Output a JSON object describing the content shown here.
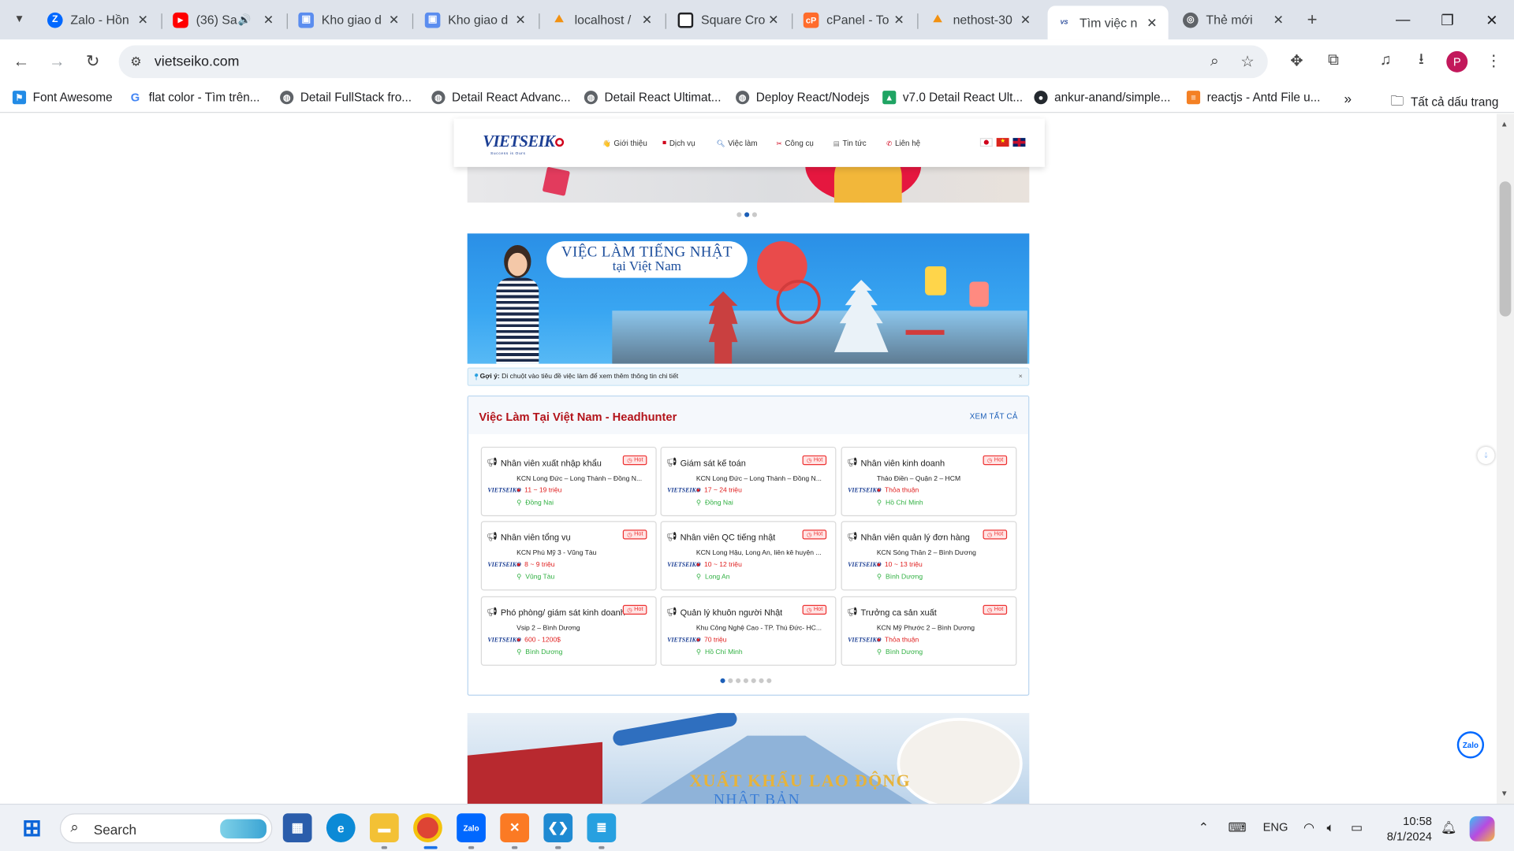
{
  "browser": {
    "tabs": [
      {
        "title": "Zalo - Hồn",
        "icon": "zalo-icon",
        "color": "#0068ff"
      },
      {
        "title": "(36) Sa",
        "icon": "youtube-icon",
        "color": "#ff0000"
      },
      {
        "title": "Kho giao d",
        "icon": "image-icon",
        "color": "#5b8def"
      },
      {
        "title": "Kho giao d",
        "icon": "image-icon",
        "color": "#5b8def"
      },
      {
        "title": "localhost /",
        "icon": "phpmyadmin-icon",
        "color": "#f29111"
      },
      {
        "title": "Square Cro",
        "icon": "square-icon",
        "color": "#202124"
      },
      {
        "title": "cPanel - To",
        "icon": "cpanel-icon",
        "color": "#ff6c2c"
      },
      {
        "title": "nethost-30",
        "icon": "phpmyadmin-icon",
        "color": "#f29111"
      },
      {
        "title": "Tìm việc n",
        "icon": "vietseiko-icon",
        "color": "#1c3f94"
      },
      {
        "title": "Thẻ mới",
        "icon": "chrome-icon",
        "color": "#5f6368"
      }
    ],
    "address": "vietseiko.com",
    "bookmarks": [
      {
        "label": "Font Awesome",
        "icon": "flag-icon",
        "color": "#228be6"
      },
      {
        "label": "flat color - Tìm trên...",
        "icon": "google-icon",
        "color": "#4285f4"
      },
      {
        "label": "Detail FullStack fro...",
        "icon": "globe-icon",
        "color": "#5f6368"
      },
      {
        "label": "Detail React Advanc...",
        "icon": "globe-icon",
        "color": "#5f6368"
      },
      {
        "label": "Detail React Ultimat...",
        "icon": "globe-icon",
        "color": "#5f6368"
      },
      {
        "label": "Deploy React/Nodejs",
        "icon": "globe-icon",
        "color": "#5f6368"
      },
      {
        "label": "v7.0 Detail React Ult...",
        "icon": "drive-icon",
        "color": "#1fa463"
      },
      {
        "label": "ankur-anand/simple...",
        "icon": "github-icon",
        "color": "#24292f"
      },
      {
        "label": "reactjs - Antd File u...",
        "icon": "stackoverflow-icon",
        "color": "#f48024"
      }
    ],
    "all_bookmarks": "Tất cả dấu trang",
    "profile_initial": "P"
  },
  "site": {
    "logo": "VIETSEIK",
    "logo_tagline": "Success is Ours",
    "menu": [
      {
        "label": "Giới thiệu",
        "icon": "hand-icon"
      },
      {
        "label": "Dịch vụ",
        "icon": "briefcase-icon"
      },
      {
        "label": "Việc làm",
        "icon": "search-icon"
      },
      {
        "label": "Công cụ",
        "icon": "tools-icon"
      },
      {
        "label": "Tin tức",
        "icon": "news-icon"
      },
      {
        "label": "Liên hệ",
        "icon": "phone-icon"
      }
    ],
    "banner": {
      "line1": "VIỆC LÀM TIẾNG NHẬT",
      "line2": "tại Việt Nam"
    },
    "hint": {
      "label": "Gợi ý:",
      "text": "Di chuột vào tiêu đề việc làm để xem thêm thông tin chi tiết",
      "close": "×"
    },
    "jobs_section": {
      "title": "Việc Làm Tại Việt Nam - Headhunter",
      "see_all": "XEM TẤT CẢ",
      "hot_label": "Hot",
      "card_logo": "VIETSEIKO",
      "jobs": [
        {
          "title": "Nhân viên xuất nhập khẩu",
          "address": "KCN Long Đức – Long Thành – Đồng N...",
          "salary": "11 ~ 19 triệu",
          "location": "Đồng Nai"
        },
        {
          "title": "Giám sát kế toán",
          "address": "KCN Long Đức – Long Thành – Đồng N...",
          "salary": "17 ~ 24 triệu",
          "location": "Đồng Nai"
        },
        {
          "title": "Nhân viên kinh doanh",
          "address": "Thảo Điền – Quận 2 – HCM",
          "salary": "Thỏa thuận",
          "location": "Hồ Chí Minh"
        },
        {
          "title": "Nhân viên tổng vụ",
          "address": "KCN Phú Mỹ 3 - Vũng Tàu",
          "salary": "8 ~ 9 triệu",
          "location": "Vũng Tàu"
        },
        {
          "title": "Nhân viên QC tiếng nhật",
          "address": "KCN Long Hậu, Long An, liền kề huyện ...",
          "salary": "10 ~ 12 triệu",
          "location": "Long An"
        },
        {
          "title": "Nhân viên quản lý đơn hàng",
          "address": "KCN Sóng Thần 2 – Bình Dương",
          "salary": "10 ~ 13 triệu",
          "location": "Bình Dương"
        },
        {
          "title": "Phó phòng/ giám sát kinh doanh",
          "address": "Vsip 2 – Bình Dương",
          "salary": "600 - 1200$",
          "location": "Bình Dương"
        },
        {
          "title": "Quản lý khuôn người Nhật",
          "address": "Khu Công Nghệ Cao - TP. Thủ Đức- HC...",
          "salary": "70 triệu",
          "location": "Hồ Chí Minh"
        },
        {
          "title": "Trưởng ca sản xuất",
          "address": "KCN Mỹ Phước 2 – Bình Dương",
          "salary": "Thỏa thuận",
          "location": "Bình Dương"
        }
      ]
    },
    "banner2": {
      "line1": "XUẤT KHẨU LAO ĐỘNG",
      "line2": "NHẬT BẢN"
    },
    "zalo_label": "Zalo"
  },
  "taskbar": {
    "search_placeholder": "Search",
    "lang": "ENG",
    "time": "10:58",
    "date": "8/1/2024"
  }
}
